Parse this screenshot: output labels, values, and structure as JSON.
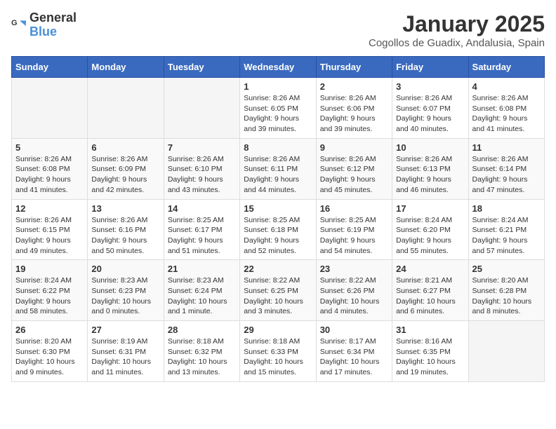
{
  "logo": {
    "text_general": "General",
    "text_blue": "Blue"
  },
  "title": "January 2025",
  "location": "Cogollos de Guadix, Andalusia, Spain",
  "weekdays": [
    "Sunday",
    "Monday",
    "Tuesday",
    "Wednesday",
    "Thursday",
    "Friday",
    "Saturday"
  ],
  "weeks": [
    [
      {
        "day": "",
        "info": ""
      },
      {
        "day": "",
        "info": ""
      },
      {
        "day": "",
        "info": ""
      },
      {
        "day": "1",
        "info": "Sunrise: 8:26 AM\nSunset: 6:05 PM\nDaylight: 9 hours and 39 minutes."
      },
      {
        "day": "2",
        "info": "Sunrise: 8:26 AM\nSunset: 6:06 PM\nDaylight: 9 hours and 39 minutes."
      },
      {
        "day": "3",
        "info": "Sunrise: 8:26 AM\nSunset: 6:07 PM\nDaylight: 9 hours and 40 minutes."
      },
      {
        "day": "4",
        "info": "Sunrise: 8:26 AM\nSunset: 6:08 PM\nDaylight: 9 hours and 41 minutes."
      }
    ],
    [
      {
        "day": "5",
        "info": "Sunrise: 8:26 AM\nSunset: 6:08 PM\nDaylight: 9 hours and 41 minutes."
      },
      {
        "day": "6",
        "info": "Sunrise: 8:26 AM\nSunset: 6:09 PM\nDaylight: 9 hours and 42 minutes."
      },
      {
        "day": "7",
        "info": "Sunrise: 8:26 AM\nSunset: 6:10 PM\nDaylight: 9 hours and 43 minutes."
      },
      {
        "day": "8",
        "info": "Sunrise: 8:26 AM\nSunset: 6:11 PM\nDaylight: 9 hours and 44 minutes."
      },
      {
        "day": "9",
        "info": "Sunrise: 8:26 AM\nSunset: 6:12 PM\nDaylight: 9 hours and 45 minutes."
      },
      {
        "day": "10",
        "info": "Sunrise: 8:26 AM\nSunset: 6:13 PM\nDaylight: 9 hours and 46 minutes."
      },
      {
        "day": "11",
        "info": "Sunrise: 8:26 AM\nSunset: 6:14 PM\nDaylight: 9 hours and 47 minutes."
      }
    ],
    [
      {
        "day": "12",
        "info": "Sunrise: 8:26 AM\nSunset: 6:15 PM\nDaylight: 9 hours and 49 minutes."
      },
      {
        "day": "13",
        "info": "Sunrise: 8:26 AM\nSunset: 6:16 PM\nDaylight: 9 hours and 50 minutes."
      },
      {
        "day": "14",
        "info": "Sunrise: 8:25 AM\nSunset: 6:17 PM\nDaylight: 9 hours and 51 minutes."
      },
      {
        "day": "15",
        "info": "Sunrise: 8:25 AM\nSunset: 6:18 PM\nDaylight: 9 hours and 52 minutes."
      },
      {
        "day": "16",
        "info": "Sunrise: 8:25 AM\nSunset: 6:19 PM\nDaylight: 9 hours and 54 minutes."
      },
      {
        "day": "17",
        "info": "Sunrise: 8:24 AM\nSunset: 6:20 PM\nDaylight: 9 hours and 55 minutes."
      },
      {
        "day": "18",
        "info": "Sunrise: 8:24 AM\nSunset: 6:21 PM\nDaylight: 9 hours and 57 minutes."
      }
    ],
    [
      {
        "day": "19",
        "info": "Sunrise: 8:24 AM\nSunset: 6:22 PM\nDaylight: 9 hours and 58 minutes."
      },
      {
        "day": "20",
        "info": "Sunrise: 8:23 AM\nSunset: 6:23 PM\nDaylight: 10 hours and 0 minutes."
      },
      {
        "day": "21",
        "info": "Sunrise: 8:23 AM\nSunset: 6:24 PM\nDaylight: 10 hours and 1 minute."
      },
      {
        "day": "22",
        "info": "Sunrise: 8:22 AM\nSunset: 6:25 PM\nDaylight: 10 hours and 3 minutes."
      },
      {
        "day": "23",
        "info": "Sunrise: 8:22 AM\nSunset: 6:26 PM\nDaylight: 10 hours and 4 minutes."
      },
      {
        "day": "24",
        "info": "Sunrise: 8:21 AM\nSunset: 6:27 PM\nDaylight: 10 hours and 6 minutes."
      },
      {
        "day": "25",
        "info": "Sunrise: 8:20 AM\nSunset: 6:28 PM\nDaylight: 10 hours and 8 minutes."
      }
    ],
    [
      {
        "day": "26",
        "info": "Sunrise: 8:20 AM\nSunset: 6:30 PM\nDaylight: 10 hours and 9 minutes."
      },
      {
        "day": "27",
        "info": "Sunrise: 8:19 AM\nSunset: 6:31 PM\nDaylight: 10 hours and 11 minutes."
      },
      {
        "day": "28",
        "info": "Sunrise: 8:18 AM\nSunset: 6:32 PM\nDaylight: 10 hours and 13 minutes."
      },
      {
        "day": "29",
        "info": "Sunrise: 8:18 AM\nSunset: 6:33 PM\nDaylight: 10 hours and 15 minutes."
      },
      {
        "day": "30",
        "info": "Sunrise: 8:17 AM\nSunset: 6:34 PM\nDaylight: 10 hours and 17 minutes."
      },
      {
        "day": "31",
        "info": "Sunrise: 8:16 AM\nSunset: 6:35 PM\nDaylight: 10 hours and 19 minutes."
      },
      {
        "day": "",
        "info": ""
      }
    ]
  ]
}
